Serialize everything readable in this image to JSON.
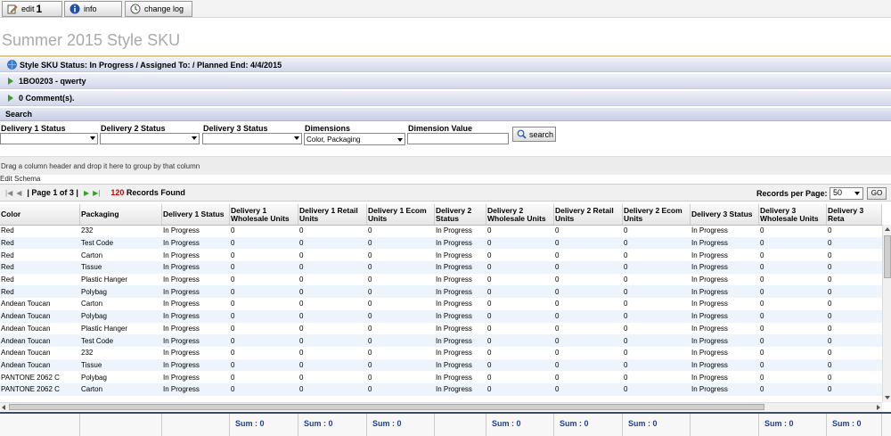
{
  "toolbar": {
    "edit_label": "edit",
    "edit_count": "1",
    "info_label": "info",
    "changelog_label": "change log"
  },
  "page": {
    "title": "Summer 2015 Style SKU"
  },
  "status_bar": {
    "text": "Style SKU  Status: In Progress / Assigned To:  / Planned End: 4/4/2015"
  },
  "item_bar": {
    "text": "1BO0203 - qwerty"
  },
  "comments_bar": {
    "text": "0 Comment(s)."
  },
  "search": {
    "header": "Search",
    "filters": {
      "d1_label": "Delivery 1 Status",
      "d2_label": "Delivery 2 Status",
      "d3_label": "Delivery 3 Status",
      "dim_label": "Dimensions",
      "dim_value": "Color, Packaging",
      "dimval_label": "Dimension Value"
    },
    "button_label": "search"
  },
  "group_hint": "Drag a column header and drop it here to group by that column",
  "edit_schema": "Edit Schema",
  "pager": {
    "page_text": "| Page 1 of 3 |",
    "records_count": "120",
    "records_label": " Records Found",
    "rpp_label": "Records per Page:",
    "rpp_value": "50",
    "go_label": "GO"
  },
  "grid": {
    "columns": [
      "Color",
      "Packaging",
      "Delivery 1 Status",
      "Delivery 1 Wholesale Units",
      "Delivery 1 Retail Units",
      "Delivery 1 Ecom Units",
      "Delivery 2 Status",
      "Delivery 2 Wholesale Units",
      "Delivery 2 Retail Units",
      "Delivery 2 Ecom Units",
      "Delivery 3 Status",
      "Delivery 3 Wholesale Units",
      "Delivery 3 Reta"
    ],
    "rows": [
      [
        "Red",
        "232",
        "In Progress",
        "0",
        "0",
        "0",
        "In Progress",
        "0",
        "0",
        "0",
        "In Progress",
        "0",
        "0"
      ],
      [
        "Red",
        "Test Code",
        "In Progress",
        "0",
        "0",
        "0",
        "In Progress",
        "0",
        "0",
        "0",
        "In Progress",
        "0",
        "0"
      ],
      [
        "Red",
        "Carton",
        "In Progress",
        "0",
        "0",
        "0",
        "In Progress",
        "0",
        "0",
        "0",
        "In Progress",
        "0",
        "0"
      ],
      [
        "Red",
        "Tissue",
        "In Progress",
        "0",
        "0",
        "0",
        "In Progress",
        "0",
        "0",
        "0",
        "In Progress",
        "0",
        "0"
      ],
      [
        "Red",
        "Plastic Hanger",
        "In Progress",
        "0",
        "0",
        "0",
        "In Progress",
        "0",
        "0",
        "0",
        "In Progress",
        "0",
        "0"
      ],
      [
        "Red",
        "Polybag",
        "In Progress",
        "0",
        "0",
        "0",
        "In Progress",
        "0",
        "0",
        "0",
        "In Progress",
        "0",
        "0"
      ],
      [
        "Andean Toucan",
        "Carton",
        "In Progress",
        "0",
        "0",
        "0",
        "In Progress",
        "0",
        "0",
        "0",
        "In Progress",
        "0",
        "0"
      ],
      [
        "Andean Toucan",
        "Polybag",
        "In Progress",
        "0",
        "0",
        "0",
        "In Progress",
        "0",
        "0",
        "0",
        "In Progress",
        "0",
        "0"
      ],
      [
        "Andean Toucan",
        "Plastic Hanger",
        "In Progress",
        "0",
        "0",
        "0",
        "In Progress",
        "0",
        "0",
        "0",
        "In Progress",
        "0",
        "0"
      ],
      [
        "Andean Toucan",
        "Test Code",
        "In Progress",
        "0",
        "0",
        "0",
        "In Progress",
        "0",
        "0",
        "0",
        "In Progress",
        "0",
        "0"
      ],
      [
        "Andean Toucan",
        "232",
        "In Progress",
        "0",
        "0",
        "0",
        "In Progress",
        "0",
        "0",
        "0",
        "In Progress",
        "0",
        "0"
      ],
      [
        "Andean Toucan",
        "Tissue",
        "In Progress",
        "0",
        "0",
        "0",
        "In Progress",
        "0",
        "0",
        "0",
        "In Progress",
        "0",
        "0"
      ],
      [
        "PANTONE 2062 C",
        "Polybag",
        "In Progress",
        "0",
        "0",
        "0",
        "In Progress",
        "0",
        "0",
        "0",
        "In Progress",
        "0",
        "0"
      ],
      [
        "PANTONE 2062 C",
        "Carton",
        "In Progress",
        "0",
        "0",
        "0",
        "In Progress",
        "0",
        "0",
        "0",
        "In Progress",
        "0",
        "0"
      ]
    ]
  },
  "footer": {
    "cells": [
      "",
      "",
      "",
      "Sum : 0",
      "Sum : 0",
      "Sum : 0",
      "",
      "Sum : 0",
      "Sum : 0",
      "Sum : 0",
      "",
      "Sum : 0",
      "Sum : 0"
    ]
  },
  "colors": {
    "accent": "#1d3f8f",
    "records_count": "#cc0000",
    "title_rule": "#e8c98a",
    "green_triangle": "#3a9c2a"
  }
}
